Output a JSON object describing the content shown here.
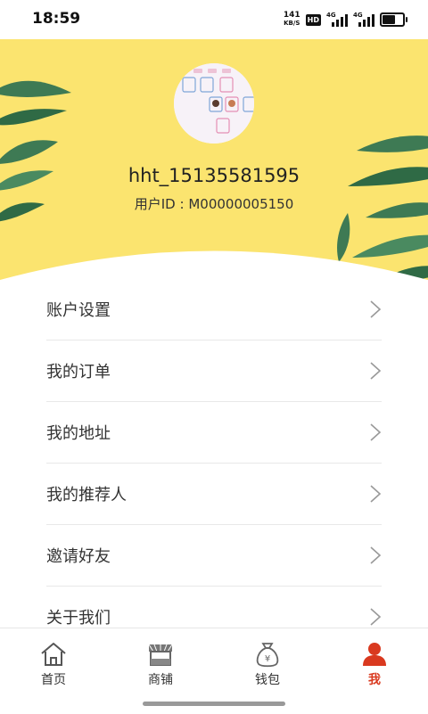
{
  "status_bar": {
    "time": "18:59",
    "net_speed": "141",
    "net_unit": "KB/S",
    "hd_badge": "HD",
    "sim1": "4G",
    "sim2": "4G",
    "battery_level": 0.8
  },
  "profile": {
    "username": "hht_15135581595",
    "user_id_label": "用户ID : ",
    "user_id": "M00000005150"
  },
  "menu": {
    "items": [
      {
        "label": "账户设置"
      },
      {
        "label": "我的订单"
      },
      {
        "label": "我的地址"
      },
      {
        "label": "我的推荐人"
      },
      {
        "label": "邀请好友"
      },
      {
        "label": "关于我们"
      }
    ]
  },
  "nav": {
    "items": [
      {
        "label": "首页",
        "icon": "home-icon",
        "active": false
      },
      {
        "label": "商铺",
        "icon": "store-icon",
        "active": false
      },
      {
        "label": "钱包",
        "icon": "money-bag-icon",
        "active": false
      },
      {
        "label": "我",
        "icon": "profile-icon",
        "active": true
      }
    ]
  },
  "colors": {
    "header_bg": "#fbe46f",
    "accent": "#d9391f",
    "leaf": "#3e7a54"
  }
}
